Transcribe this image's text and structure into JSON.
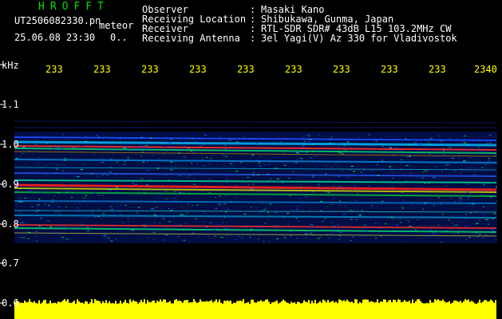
{
  "header": {
    "brand": "HROFFT",
    "filename": "UT2506082330.pn",
    "tag": "meteor",
    "datetime": "25.06.08 23:30",
    "counter": "0.."
  },
  "meta": [
    {
      "label": "Observer",
      "value": "Masaki Kano"
    },
    {
      "label": "Receiving Location",
      "value": "Shibukawa, Gunma, Japan"
    },
    {
      "label": "Receiver",
      "value": "RTL-SDR SDR# 43dB L15 103.2MHz CW"
    },
    {
      "label": "Receiving Antenna",
      "value": "3el Yagi(V) Az 330 for Vladivostok"
    }
  ],
  "axis": {
    "unit": "kHz",
    "y_labels": [
      "1.1",
      "1.0",
      "0.9",
      "0.8",
      "0.7",
      "0.6"
    ],
    "x_labels": [
      "233",
      "233",
      "233",
      "233",
      "233",
      "233",
      "233",
      "233",
      "233",
      "2340"
    ]
  },
  "colors": {
    "background": "#000000",
    "brand": "#00e000",
    "tick": "#ffff00",
    "echo_bar": "#ffff00"
  }
}
